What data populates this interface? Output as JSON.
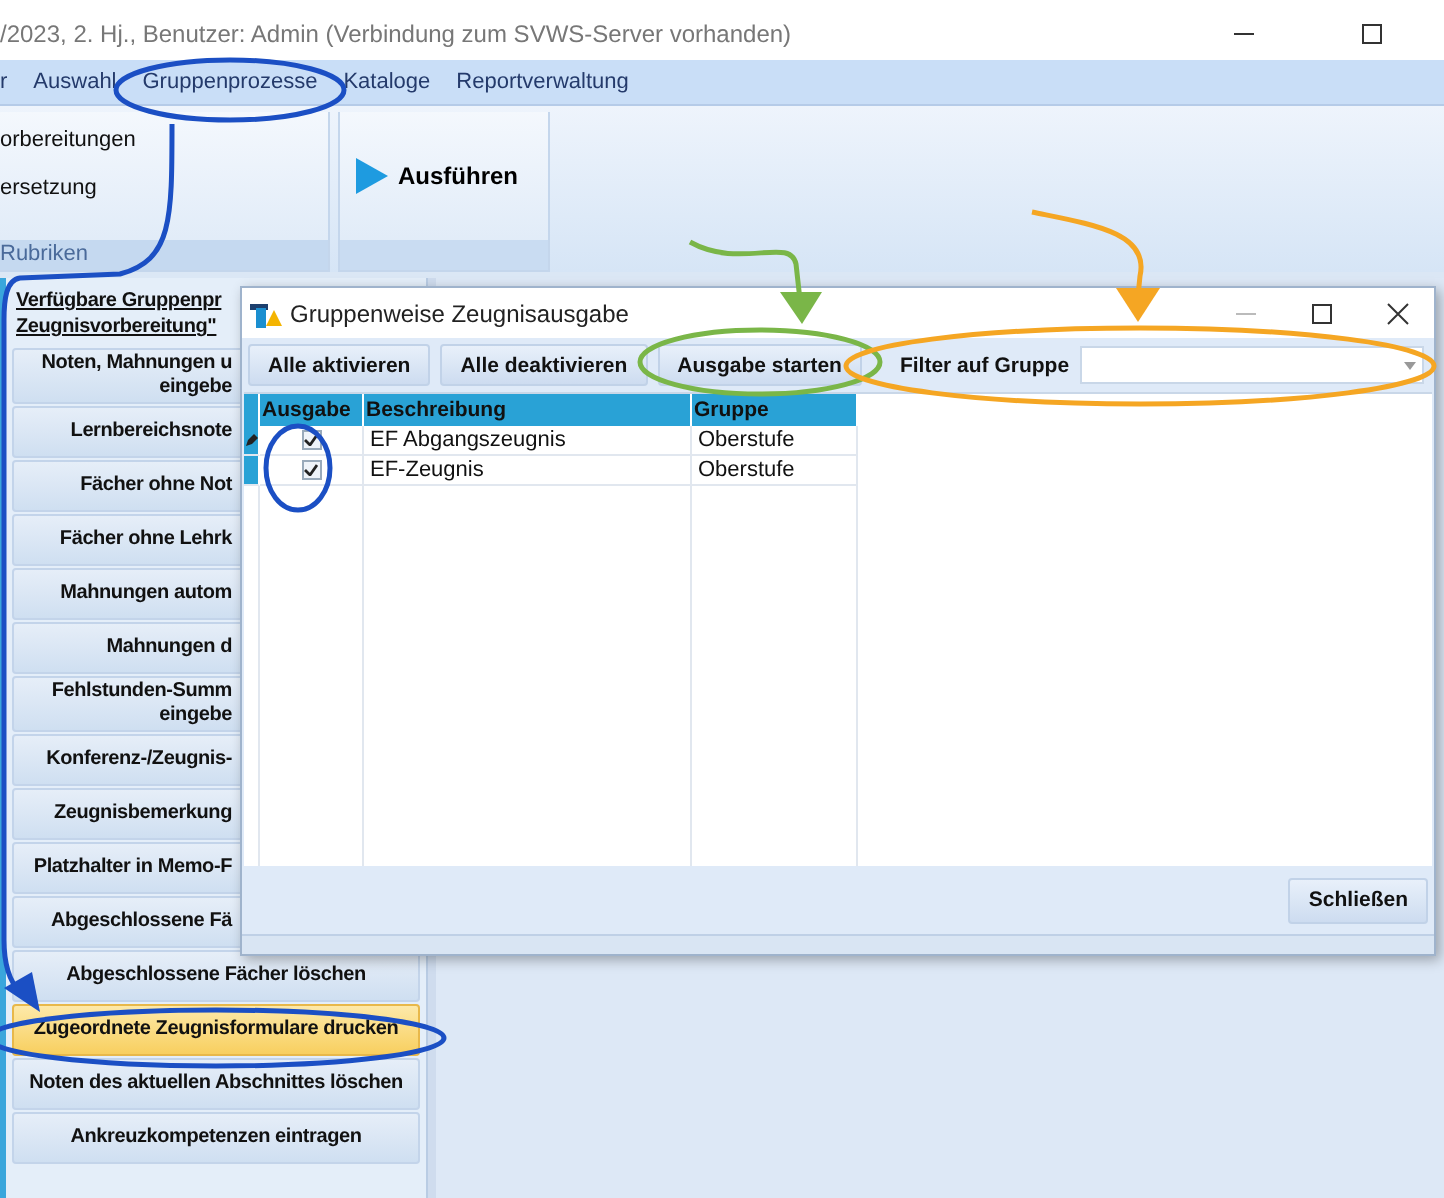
{
  "window": {
    "title": "/2023, 2. Hj., Benutzer: Admin (Verbindung zum SVWS-Server vorhanden)"
  },
  "menu": [
    "r",
    "Auswahl",
    "Gruppenprozesse",
    "Kataloge",
    "Reportverwaltung"
  ],
  "ribbon": {
    "group_1": {
      "items": [
        "orbereitungen",
        "ersetzung"
      ],
      "label": "Rubriken"
    },
    "group_2": {
      "button": "Ausführen"
    }
  },
  "sidebar": {
    "heading": "Verfügbare Gruppenpr\nZeugnisvorbereitung\"",
    "items": [
      {
        "label": "Noten, Mahnungen u\neingebe",
        "kind": "cut",
        "selected": false
      },
      {
        "label": "Lernbereichsnote",
        "kind": "cut",
        "selected": false
      },
      {
        "label": "Fächer ohne Not",
        "kind": "cut",
        "selected": false
      },
      {
        "label": "Fächer ohne Lehrk",
        "kind": "cut",
        "selected": false
      },
      {
        "label": "Mahnungen autom",
        "kind": "cut",
        "selected": false
      },
      {
        "label": "Mahnungen d",
        "kind": "cut",
        "selected": false
      },
      {
        "label": "Fehlstunden-Summ\neingebe",
        "kind": "cut",
        "selected": false
      },
      {
        "label": "Konferenz-/Zeugnis-",
        "kind": "cut",
        "selected": false
      },
      {
        "label": "Zeugnisbemerkung",
        "kind": "cut",
        "selected": false
      },
      {
        "label": "Platzhalter in Memo-F",
        "kind": "cut",
        "selected": false
      },
      {
        "label": "Abgeschlossene Fä",
        "kind": "cut",
        "selected": false
      },
      {
        "label": "Abgeschlossene Fächer löschen",
        "kind": "full",
        "selected": false
      },
      {
        "label": "Zugeordnete Zeugnisformulare drucken",
        "kind": "full",
        "selected": true
      },
      {
        "label": "Noten des aktuellen Abschnittes löschen",
        "kind": "full",
        "selected": false
      },
      {
        "label": "Ankreuzkompetenzen eintragen",
        "kind": "full",
        "selected": false
      }
    ]
  },
  "dialog": {
    "title": "Gruppenweise Zeugnisausgabe",
    "toolbar": {
      "buttons": [
        "Alle aktivieren",
        "Alle deaktivieren",
        "Ausgabe starten"
      ],
      "filter_label": "Filter auf Gruppe"
    },
    "grid": {
      "columns": [
        "Ausgabe",
        "Beschreibung",
        "Gruppe"
      ],
      "rows": [
        {
          "checked": true,
          "current": true,
          "description": "EF Abgangszeugnis",
          "group": "Oberstufe"
        },
        {
          "checked": true,
          "current": false,
          "description": "EF-Zeugnis",
          "group": "Oberstufe"
        }
      ]
    },
    "close_button": "Schließen"
  }
}
